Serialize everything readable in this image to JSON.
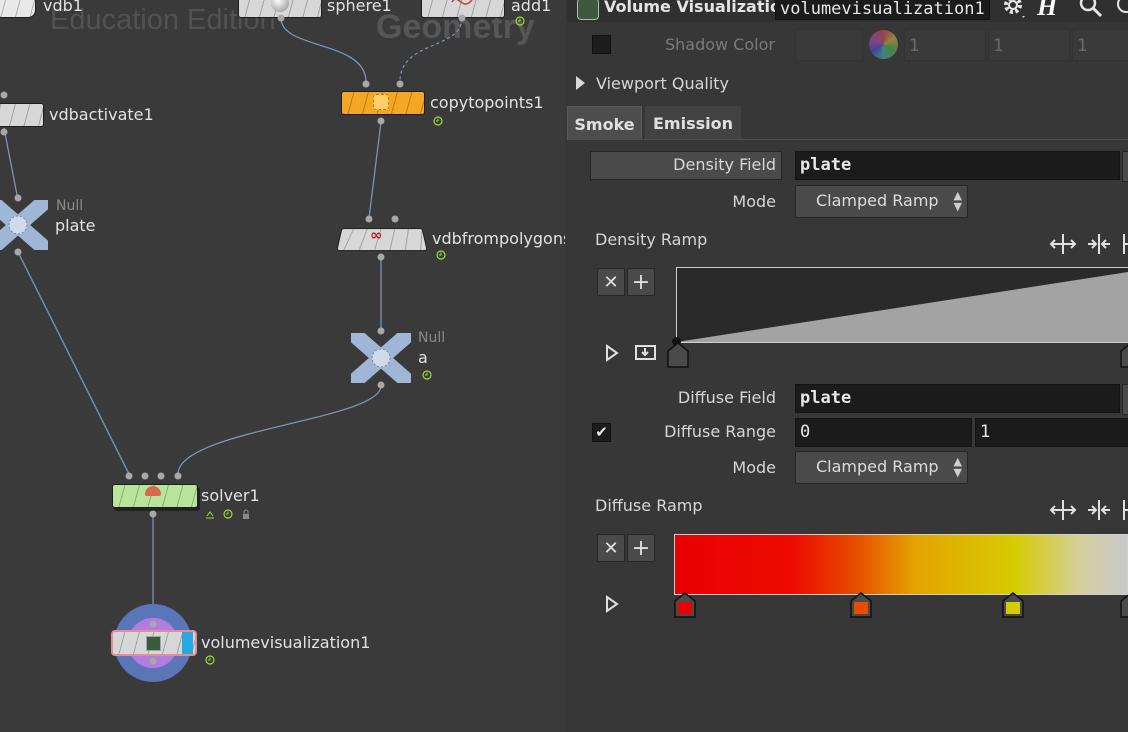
{
  "network": {
    "watermark_edition": "Education Edition",
    "watermark_context": "Geometry",
    "nodes": {
      "vdb1": "vdb1",
      "sphere1": "sphere1",
      "add1": "add1",
      "copytopoints1": "copytopoints1",
      "vdbactivate1": "vdbactivate1",
      "plate_type": "Null",
      "plate": "plate",
      "vdbfrompolygons": "vdbfrompolygons",
      "a_type": "Null",
      "a": "a",
      "solver1": "solver1",
      "volumevisualization1": "volumevisualization1"
    },
    "colors": {
      "copytopoints": "#f5a623",
      "solver": "#b9e59a",
      "vis_accent": "#29a7e0",
      "wire": "#7e9ac0"
    }
  },
  "params": {
    "node_type": "Volume Visualization",
    "node_name": "volumevisualization1",
    "shadow_color_label": "Shadow Color",
    "shadow_values": [
      "1",
      "1",
      "1"
    ],
    "viewport_quality_label": "Viewport Quality",
    "tabs": [
      "Smoke",
      "Emission"
    ],
    "density_field_label": "Density Field",
    "density_field_value": "plate",
    "mode_label": "Mode",
    "density_mode": "Clamped Ramp",
    "density_ramp_label": "Density Ramp",
    "diffuse_field_label": "Diffuse Field",
    "diffuse_field_value": "plate",
    "diffuse_range_label": "Diffuse Range",
    "diffuse_range_min": "0",
    "diffuse_range_max": "1",
    "diffuse_mode_label": "Mode",
    "diffuse_mode": "Clamped Ramp",
    "diffuse_ramp_label": "Diffuse Ramp",
    "diffuse_ramp_colors": [
      "#e90000",
      "#ee0a00",
      "#e64d00",
      "#e4a300",
      "#d6cb00",
      "#d5d0a0",
      "#c8c8c8"
    ]
  }
}
